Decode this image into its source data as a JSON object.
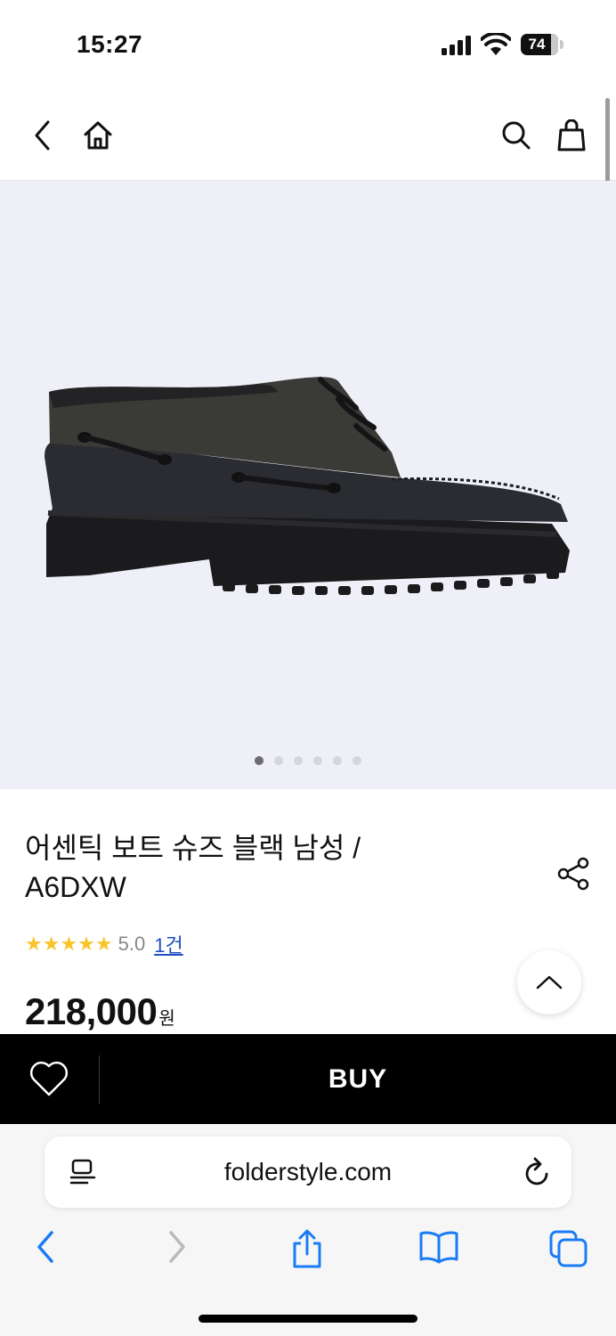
{
  "status": {
    "time": "15:27",
    "battery": "74"
  },
  "header": {
    "icons": [
      "back-icon",
      "home-icon",
      "search-icon",
      "bag-icon"
    ]
  },
  "gallery": {
    "image": "black boat shoe",
    "slides": 6,
    "active_slide": 1
  },
  "product": {
    "title": "어센틱 보트 슈즈 블랙 남성 / A6DXW",
    "stars": "★★★★★",
    "rating": "5.0",
    "review_count": "1건",
    "price": "218,000",
    "currency": "원"
  },
  "buy_bar": {
    "buy_label": "BUY"
  },
  "browser": {
    "url": "folderstyle.com"
  },
  "colors": {
    "accent_star": "#f7c52b",
    "link": "#1f4fbf",
    "buy_bg": "#000000",
    "safari_blue": "#1a7cf5"
  }
}
